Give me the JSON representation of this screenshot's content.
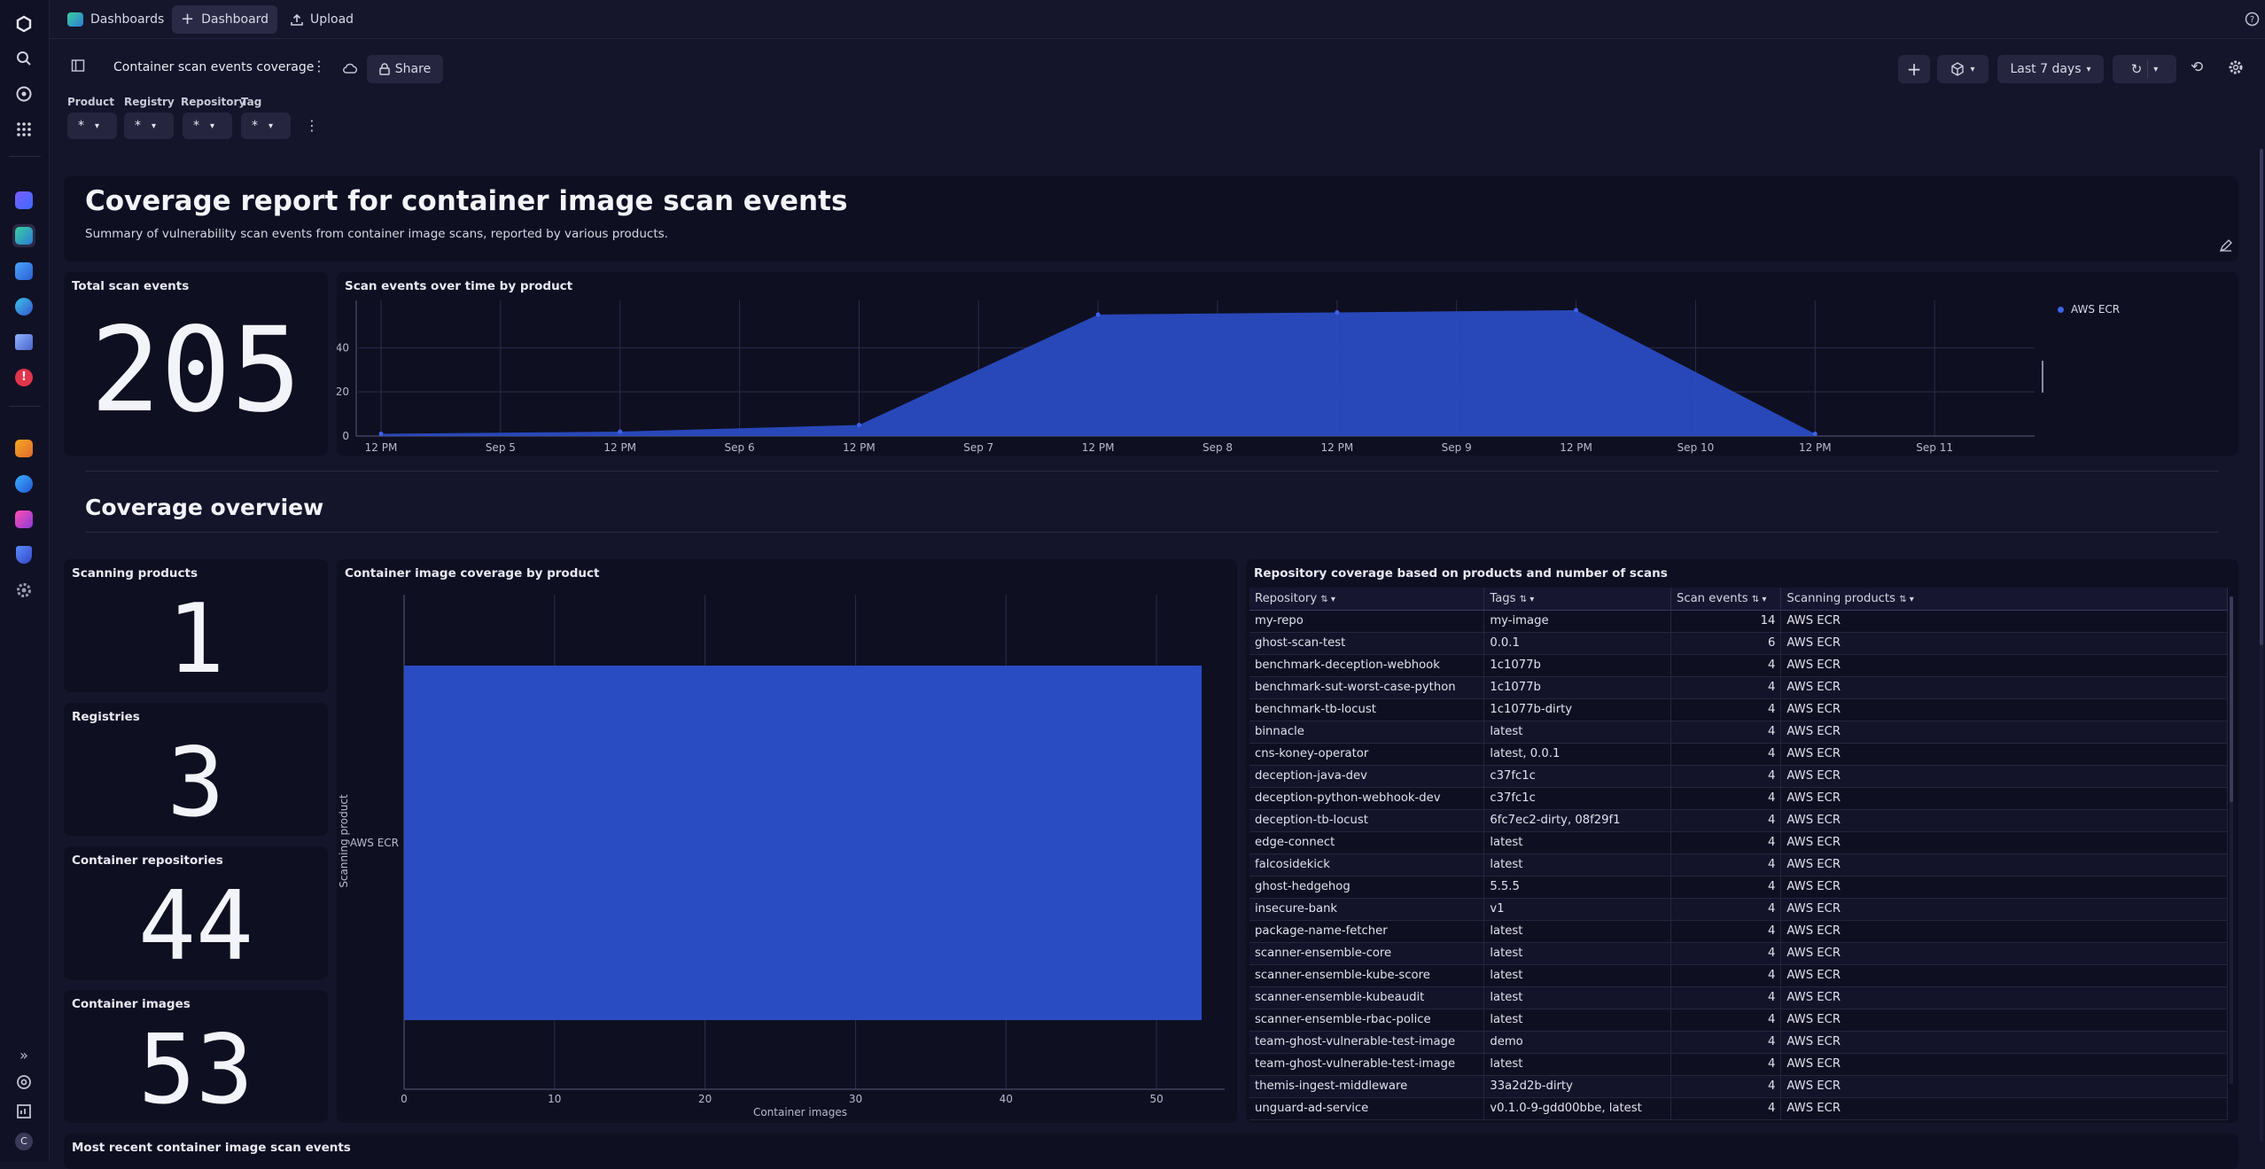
{
  "topbar": {
    "app_label": "Dashboards",
    "dashboard_label": "Dashboard",
    "upload_label": "Upload"
  },
  "toolbar": {
    "title": "Container scan events coverage",
    "share_label": "Share",
    "timeframe_label": "Last 7 days"
  },
  "filters": [
    {
      "label": "Product",
      "value": "*"
    },
    {
      "label": "Registry",
      "value": "*"
    },
    {
      "label": "Repository",
      "value": "*"
    },
    {
      "label": "Tag",
      "value": "*"
    }
  ],
  "header": {
    "title": "Coverage report for container image scan events",
    "subtitle": "Summary of vulnerability scan events from container image scans, reported by various products."
  },
  "total_scan": {
    "title": "Total scan events",
    "value": "205"
  },
  "section_title": "Coverage overview",
  "stats": [
    {
      "title": "Scanning products",
      "value": "1"
    },
    {
      "title": "Registries",
      "value": "3"
    },
    {
      "title": "Container repositories",
      "value": "44"
    },
    {
      "title": "Container images",
      "value": "53"
    }
  ],
  "bottom_title": "Most recent container image scan events",
  "colors": {
    "series": "#2a4cc2",
    "background": "#14142a"
  },
  "chart_data": [
    {
      "type": "area",
      "title": "Scan events over time by product",
      "x_ticks": [
        "12 PM",
        "Sep 5",
        "12 PM",
        "Sep 6",
        "12 PM",
        "Sep 7",
        "12 PM",
        "Sep 8",
        "12 PM",
        "Sep 9",
        "12 PM",
        "Sep 10",
        "12 PM",
        "Sep 11"
      ],
      "y_ticks": [
        "0",
        "20",
        "40"
      ],
      "ylim": [
        0,
        59
      ],
      "x": [
        "Sep 4 12 PM",
        "Sep 5 12 PM",
        "Sep 6 12 PM",
        "Sep 7 12 PM",
        "Sep 8 12 PM",
        "Sep 9 12 PM",
        "Sep 10 12 PM"
      ],
      "series": [
        {
          "name": "AWS ECR",
          "values": [
            1,
            2,
            5,
            55,
            56,
            57,
            1
          ]
        }
      ],
      "legend": "top-right"
    },
    {
      "type": "bar",
      "orientation": "horizontal",
      "title": "Container image coverage by product",
      "xlabel": "Container images",
      "ylabel": "Scanning product",
      "categories": [
        "AWS ECR"
      ],
      "values": [
        53
      ],
      "x_ticks": [
        "0",
        "10",
        "20",
        "30",
        "40",
        "50"
      ],
      "xlim": [
        0,
        55
      ]
    }
  ],
  "table": {
    "title": "Repository coverage based on products and number of scans",
    "columns": [
      "Repository",
      "Tags",
      "Scan events",
      "Scanning products"
    ],
    "rows": [
      [
        "my-repo",
        "my-image",
        "14",
        "AWS ECR"
      ],
      [
        "ghost-scan-test",
        "0.0.1",
        "6",
        "AWS ECR"
      ],
      [
        "benchmark-deception-webhook",
        "1c1077b",
        "4",
        "AWS ECR"
      ],
      [
        "benchmark-sut-worst-case-python",
        "1c1077b",
        "4",
        "AWS ECR"
      ],
      [
        "benchmark-tb-locust",
        "1c1077b-dirty",
        "4",
        "AWS ECR"
      ],
      [
        "binnacle",
        "latest",
        "4",
        "AWS ECR"
      ],
      [
        "cns-koney-operator",
        "latest, 0.0.1",
        "4",
        "AWS ECR"
      ],
      [
        "deception-java-dev",
        "c37fc1c",
        "4",
        "AWS ECR"
      ],
      [
        "deception-python-webhook-dev",
        "c37fc1c",
        "4",
        "AWS ECR"
      ],
      [
        "deception-tb-locust",
        "6fc7ec2-dirty, 08f29f1",
        "4",
        "AWS ECR"
      ],
      [
        "edge-connect",
        "latest",
        "4",
        "AWS ECR"
      ],
      [
        "falcosidekick",
        "latest",
        "4",
        "AWS ECR"
      ],
      [
        "ghost-hedgehog",
        "5.5.5",
        "4",
        "AWS ECR"
      ],
      [
        "insecure-bank",
        "v1",
        "4",
        "AWS ECR"
      ],
      [
        "package-name-fetcher",
        "latest",
        "4",
        "AWS ECR"
      ],
      [
        "scanner-ensemble-core",
        "latest",
        "4",
        "AWS ECR"
      ],
      [
        "scanner-ensemble-kube-score",
        "latest",
        "4",
        "AWS ECR"
      ],
      [
        "scanner-ensemble-kubeaudit",
        "latest",
        "4",
        "AWS ECR"
      ],
      [
        "scanner-ensemble-rbac-police",
        "latest",
        "4",
        "AWS ECR"
      ],
      [
        "team-ghost-vulnerable-test-image",
        "demo",
        "4",
        "AWS ECR"
      ],
      [
        "team-ghost-vulnerable-test-image",
        "latest",
        "4",
        "AWS ECR"
      ],
      [
        "themis-ingest-middleware",
        "33a2d2b-dirty",
        "4",
        "AWS ECR"
      ],
      [
        "unguard-ad-service",
        "v0.1.0-9-gdd00bbe, latest",
        "4",
        "AWS ECR"
      ]
    ]
  }
}
